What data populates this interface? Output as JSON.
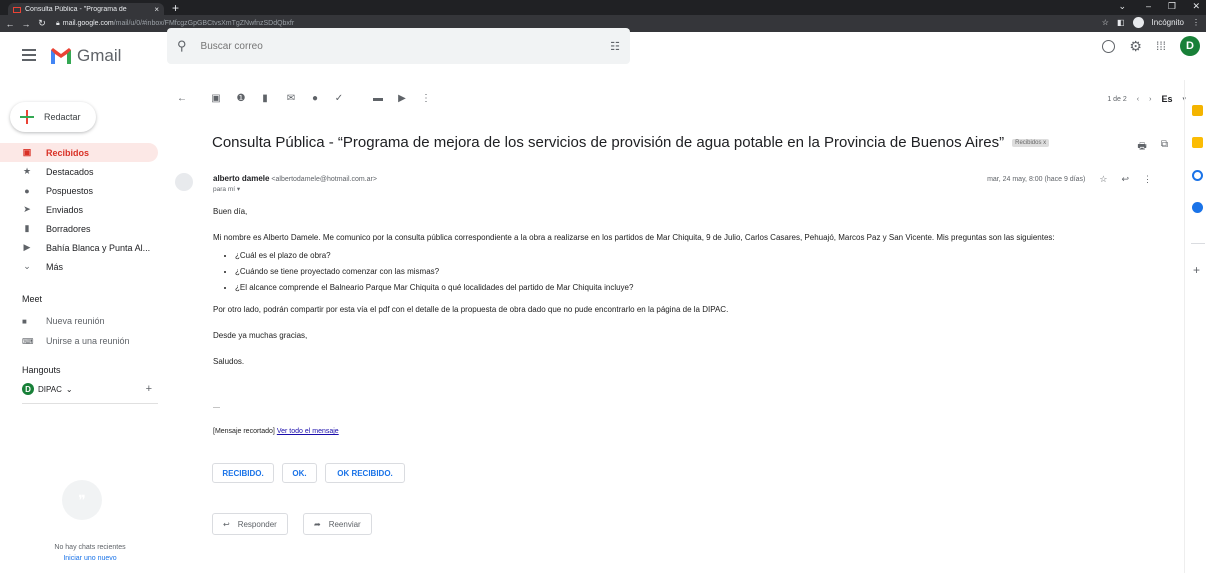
{
  "browser": {
    "tab_title": "Consulta Pública - \"Programa de",
    "tab_close": "×",
    "new_tab": "+",
    "url_host": "mail.google.com",
    "url_path": "/mail/u/0/#inbox/FMfcgzGpGBCtvsXmTgZNwfnzSDdQbxfr",
    "incognito": "Incógnito"
  },
  "gmail": {
    "app_name": "Gmail",
    "search_placeholder": "Buscar correo",
    "avatar_letter": "D"
  },
  "sidebar": {
    "compose": "Redactar",
    "items": [
      {
        "label": "Recibidos",
        "icon": "inbox-icon"
      },
      {
        "label": "Destacados",
        "icon": "star-icon"
      },
      {
        "label": "Pospuestos",
        "icon": "clock-icon"
      },
      {
        "label": "Enviados",
        "icon": "send-icon"
      },
      {
        "label": "Borradores",
        "icon": "draft-icon"
      },
      {
        "label": "Bahía Blanca y Punta Al...",
        "icon": "label-icon"
      },
      {
        "label": "Más",
        "icon": "chevron-down-icon"
      }
    ],
    "meet_title": "Meet",
    "meet_new": "Nueva reunión",
    "meet_join": "Unirse a una reunión",
    "hangouts_title": "Hangouts",
    "hangouts_user": "DIPAC",
    "hangouts_user_letter": "D",
    "no_chats": "No hay chats recientes",
    "start_new": "Iniciar uno nuevo"
  },
  "toolbar": {
    "pager": "1 de 2",
    "lang": "Es"
  },
  "email": {
    "subject": "Consulta Pública - “Programa de mejora de los servicios de provisión de agua potable en la Provincia de Buenos Aires”",
    "label": "Recibidos x",
    "sender_name": "alberto damele",
    "sender_email": "<albertodamele@hotmail.com.ar>",
    "to": "para mí",
    "date": "mar, 24 may, 8:00 (hace 9 días)",
    "greeting": "Buen día,",
    "para1": "Mi nombre es Alberto Damele. Me comunico por la consulta pública correspondiente a la obra a realizarse en los partidos de Mar Chiquita, 9 de Julio, Carlos Casares, Pehuajó, Marcos Paz y San Vicente. Mis preguntas son las siguientes:",
    "questions": [
      "¿Cuál es el plazo de obra?",
      "¿Cuándo se tiene proyectado comenzar con las mismas?",
      "¿El alcance comprende el Balneario Parque Mar Chiquita o qué localidades del partido de Mar Chiquita incluye?"
    ],
    "para2": "Por otro lado, podrán compartir por esta vía el pdf con el detalle de la propuesta de obra dado que no pude encontrarlo en la página de la DIPAC.",
    "thanks": "Desde ya muchas gracias,",
    "bye": "Saludos.",
    "dots": "—",
    "clipped": "[Mensaje recortado]",
    "view_all": "Ver todo el mensaje"
  },
  "quick_replies": [
    "RECIBIDO.",
    "OK.",
    "OK RECIBIDO."
  ],
  "actions": {
    "reply": "Responder",
    "forward": "Reenviar"
  }
}
